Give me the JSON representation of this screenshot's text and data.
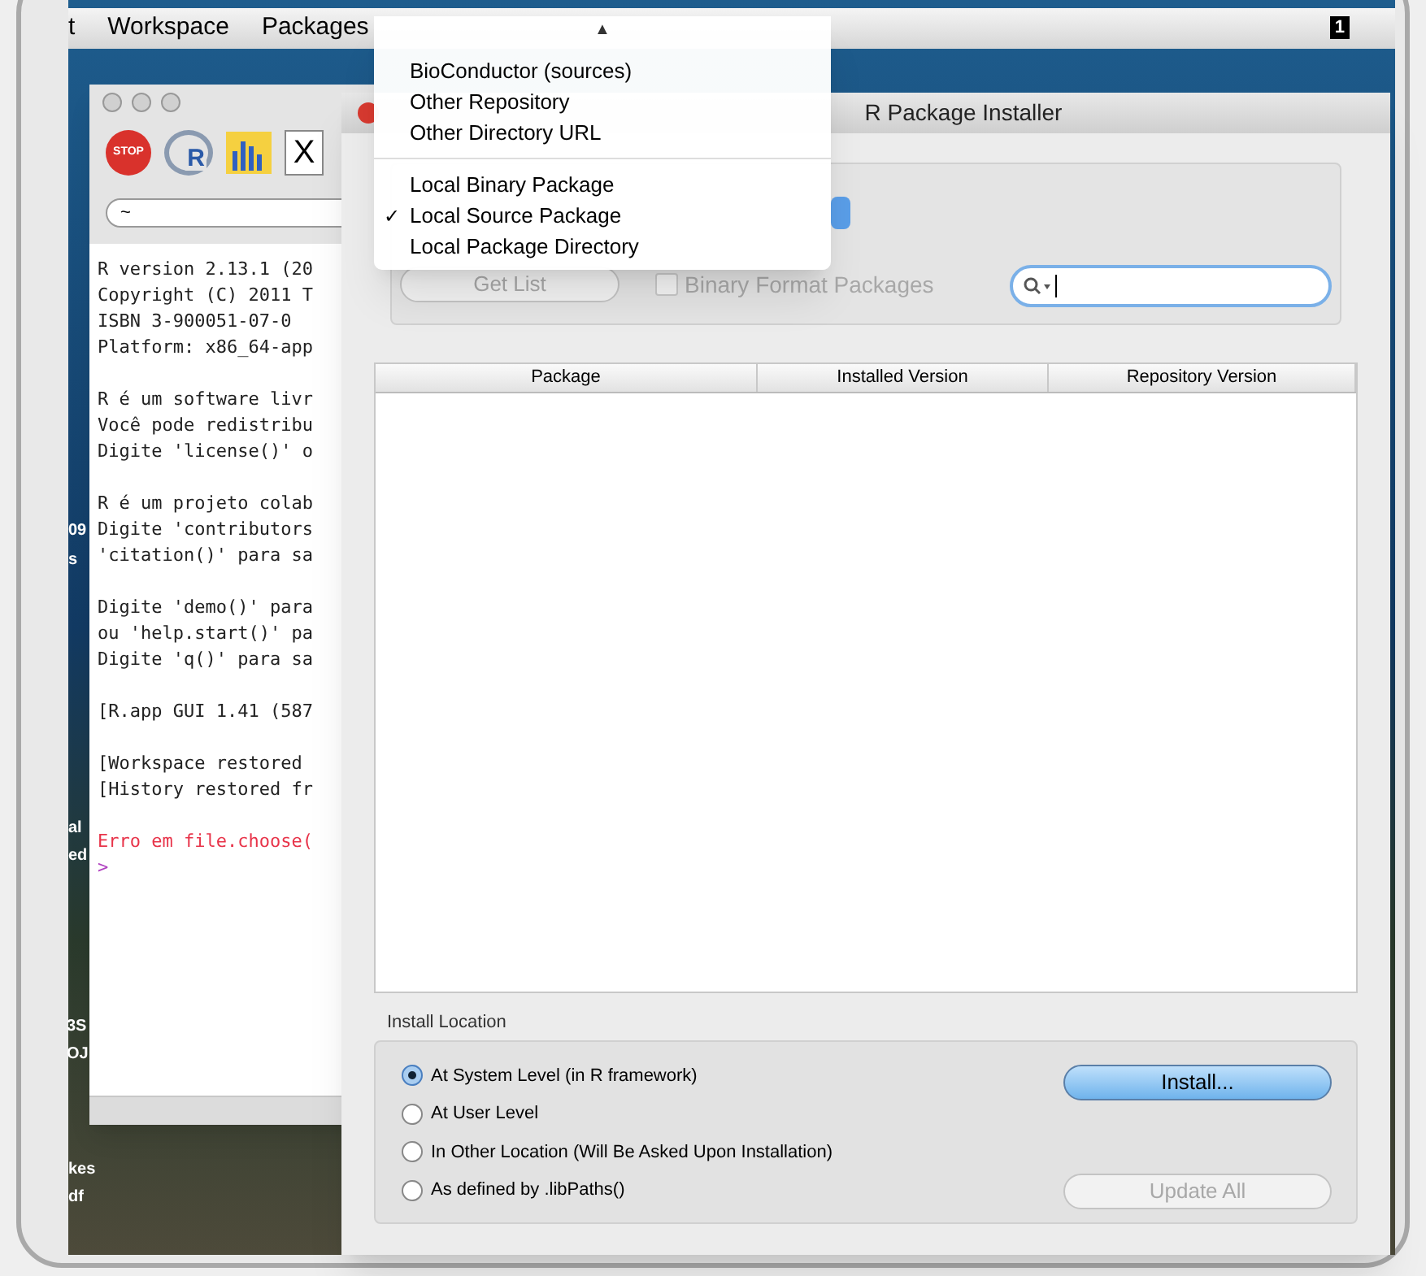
{
  "menu_bar": {
    "items": [
      "t",
      "Workspace",
      "Packages"
    ],
    "status_badge": "1"
  },
  "desktop_labels": [
    "09",
    "s",
    "al",
    "ed",
    "3S",
    "OJ",
    "kes",
    "df"
  ],
  "console": {
    "toolbar": [
      {
        "kind": "stop",
        "label": "STOP"
      },
      {
        "kind": "r",
        "label": "R"
      },
      {
        "kind": "chart"
      },
      {
        "kind": "x",
        "label": "X"
      }
    ],
    "path": "~",
    "lines": [
      {
        "text": "R version 2.13.1 (20",
        "kind": "normal"
      },
      {
        "text": "Copyright (C) 2011 T",
        "kind": "normal"
      },
      {
        "text": "ISBN 3-900051-07-0",
        "kind": "normal"
      },
      {
        "text": "Platform: x86_64-app",
        "kind": "normal"
      },
      {
        "kind": "blank"
      },
      {
        "text": "R é um software livr",
        "kind": "normal"
      },
      {
        "text": "Você pode redistribu",
        "kind": "normal"
      },
      {
        "text": "Digite 'license()' o",
        "kind": "normal"
      },
      {
        "kind": "blank"
      },
      {
        "text": "R é um projeto colab",
        "kind": "normal"
      },
      {
        "text": "Digite 'contributors",
        "kind": "normal"
      },
      {
        "text": "'citation()' para sa",
        "kind": "normal"
      },
      {
        "kind": "blank"
      },
      {
        "text": "Digite 'demo()' para",
        "kind": "normal"
      },
      {
        "text": "ou 'help.start()' pa",
        "kind": "normal"
      },
      {
        "text": "Digite 'q()' para sa",
        "kind": "normal"
      },
      {
        "kind": "blank"
      },
      {
        "text": "[R.app GUI 1.41 (587",
        "kind": "normal"
      },
      {
        "kind": "blank"
      },
      {
        "text": "[Workspace restored ",
        "kind": "normal"
      },
      {
        "text": "[History restored fr",
        "kind": "normal"
      },
      {
        "kind": "blank"
      },
      {
        "text": "Erro em file.choose(",
        "kind": "error"
      },
      {
        "text": ">",
        "kind": "prompt"
      }
    ]
  },
  "installer": {
    "title": "R Package Installer",
    "get_list": {
      "label": "Get List",
      "disabled": true
    },
    "binary_checkbox": {
      "label": "Binary Format Packages",
      "checked": false,
      "disabled": true
    },
    "table": {
      "columns": [
        "Package",
        "Installed Version",
        "Repository Version"
      ]
    },
    "install_location": {
      "title": "Install Location",
      "options": [
        {
          "label": "At System Level (in R framework)",
          "selected": true
        },
        {
          "label": "At User Level",
          "selected": false
        },
        {
          "label": "In Other Location (Will Be Asked Upon Installation)",
          "selected": false
        },
        {
          "label": "As defined by .libPaths()",
          "selected": false
        }
      ],
      "install_button": {
        "label": "Install...",
        "disabled": false
      },
      "update_button": {
        "label": "Update All",
        "disabled": true
      }
    }
  },
  "source_menu": {
    "scroll_arrow": "▲",
    "sections": [
      [
        {
          "label": "BioConductor (sources)",
          "checked": false
        },
        {
          "label": "Other Repository",
          "checked": false
        },
        {
          "label": "Other Directory URL",
          "checked": false
        }
      ],
      [
        {
          "label": "Local Binary Package",
          "checked": false
        },
        {
          "label": "Local Source Package",
          "checked": true
        },
        {
          "label": "Local Package Directory",
          "checked": false
        }
      ]
    ],
    "check_mark": "✓"
  }
}
